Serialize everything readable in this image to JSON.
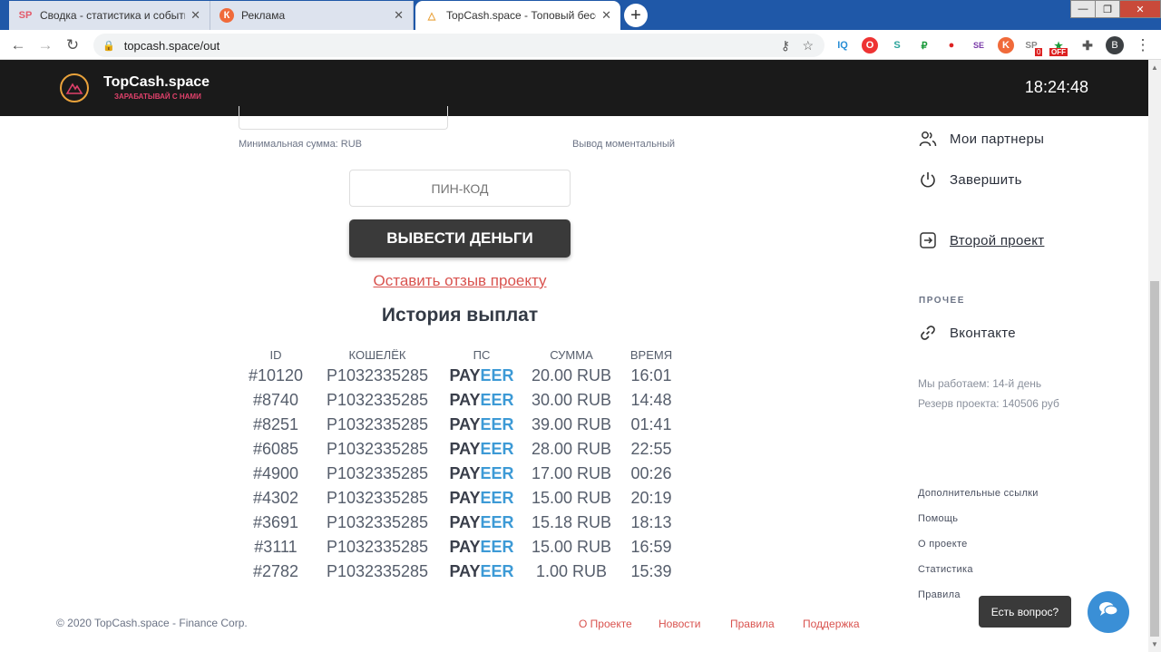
{
  "browser": {
    "tabs": [
      {
        "icon": "SP",
        "title": "Сводка - статистика и события"
      },
      {
        "icon": "К",
        "title": "Реклама"
      },
      {
        "icon": "△",
        "title": "TopCash.space - Топовый бесср"
      }
    ],
    "url": "topcash.space/out",
    "profile_initial": "B",
    "extensions": [
      "IQ",
      "O",
      "S",
      "₽",
      "●",
      "SE",
      "K",
      "SP",
      "★",
      "✚"
    ],
    "badge_0": "0",
    "badge_off": "OFF"
  },
  "header": {
    "logo_title": "TopCash.space",
    "logo_subtitle": "ЗАРАБАТЫВАЙ С НАМИ",
    "clock": "18:24:48"
  },
  "form": {
    "min_sum": "Минимальная сумма: RUB",
    "instant": "Вывод моментальный",
    "pin_placeholder": "ПИН-КОД",
    "withdraw_label": "ВЫВЕСТИ ДЕНЬГИ",
    "review_link": "Оставить отзыв проекту"
  },
  "history": {
    "title": "История выплат",
    "columns": [
      "ID",
      "КОШЕЛЁК",
      "ПС",
      "СУММА",
      "ВРЕМЯ"
    ],
    "rows": [
      {
        "id": "#10120",
        "wallet": "P1032335285",
        "ps_a": "PAY",
        "ps_b": "EER",
        "sum": "20.00 RUB",
        "time": "16:01"
      },
      {
        "id": "#8740",
        "wallet": "P1032335285",
        "ps_a": "PAY",
        "ps_b": "EER",
        "sum": "30.00 RUB",
        "time": "14:48"
      },
      {
        "id": "#8251",
        "wallet": "P1032335285",
        "ps_a": "PAY",
        "ps_b": "EER",
        "sum": "39.00 RUB",
        "time": "01:41"
      },
      {
        "id": "#6085",
        "wallet": "P1032335285",
        "ps_a": "PAY",
        "ps_b": "EER",
        "sum": "28.00 RUB",
        "time": "22:55"
      },
      {
        "id": "#4900",
        "wallet": "P1032335285",
        "ps_a": "PAY",
        "ps_b": "EER",
        "sum": "17.00 RUB",
        "time": "00:26"
      },
      {
        "id": "#4302",
        "wallet": "P1032335285",
        "ps_a": "PAY",
        "ps_b": "EER",
        "sum": "15.00 RUB",
        "time": "20:19"
      },
      {
        "id": "#3691",
        "wallet": "P1032335285",
        "ps_a": "PAY",
        "ps_b": "EER",
        "sum": "15.18 RUB",
        "time": "18:13"
      },
      {
        "id": "#3111",
        "wallet": "P1032335285",
        "ps_a": "PAY",
        "ps_b": "EER",
        "sum": "15.00 RUB",
        "time": "16:59"
      },
      {
        "id": "#2782",
        "wallet": "P1032335285",
        "ps_a": "PAY",
        "ps_b": "EER",
        "sum": "1.00 RUB",
        "time": "15:39"
      }
    ]
  },
  "sidebar": {
    "partners": "Мои партнеры",
    "logout": "Завершить",
    "second_project": "Второй проект",
    "other_label": "ПРОЧЕЕ",
    "vk": "Вконтакте",
    "working_days": "Мы работаем: 14-й день",
    "reserve": "Резерв проекта: 140506 руб",
    "links": [
      "Дополнительные ссылки",
      "Помощь",
      "О проекте",
      "Статистика",
      "Правила"
    ]
  },
  "footer": {
    "copyright": "© 2020 TopCash.space - Finance Corp.",
    "links": [
      "О Проекте",
      "Новости",
      "Правила",
      "Поддержка"
    ]
  },
  "chat": {
    "tooltip": "Есть вопрос?"
  }
}
